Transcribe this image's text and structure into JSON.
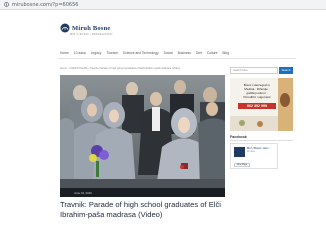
{
  "browser": {
    "url": "mirubosne.com/?p=60656"
  },
  "site": {
    "logo_text": "Miruh Bosne",
    "tagline": "MIR U BOSNI I HERCEGOVINI"
  },
  "nav": {
    "items": [
      "Home",
      "10 dana",
      "Legacy",
      "Tourism",
      "Science and Technology",
      "Social",
      "Business",
      "Diet",
      "Culture",
      "Blog"
    ]
  },
  "breadcrumb": "Home › VIJESTI ISLAM › Travnik: Parade of high school graduates of Elči Ibrahim-paša madrasa (Video)",
  "article": {
    "date": "June 19, 2019",
    "title": "Travnik: Parade of high school graduates of Elči Ibrahim-paša madrasa (Video)"
  },
  "sidebar": {
    "search_placeholder": "search here",
    "search_button": "Search",
    "ad_text": "Bosni i Hercegovini. Medina · Džamije · godišnji odmor · Porodični i sigurnost",
    "ad_phone": "062 392 999",
    "facebook_heading": "Facebook",
    "fb_page_name": "Mir U Bosni i Herc...",
    "fb_likes": "2K likes",
    "fb_like_label": "Like Page"
  },
  "colors": {
    "accent": "#1f6fbf",
    "title": "#1f2a3a",
    "meta_bar": "#1a1d22",
    "ad_phone": "#c8342a"
  }
}
